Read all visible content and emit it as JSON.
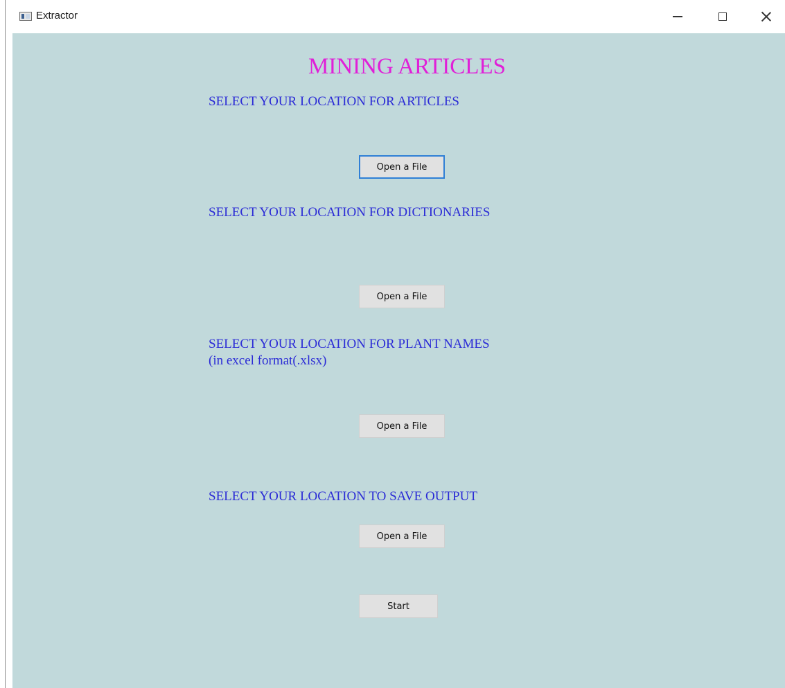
{
  "window": {
    "title": "Extractor"
  },
  "app": {
    "title": "MINING ARTICLES"
  },
  "sections": {
    "articles": {
      "label": "SELECT YOUR LOCATION FOR ARTICLES",
      "button_label": "Open a File"
    },
    "dictionaries": {
      "label": "SELECT YOUR LOCATION FOR DICTIONARIES",
      "button_label": "Open a File"
    },
    "plant_names": {
      "label": "SELECT YOUR LOCATION FOR PLANT NAMES",
      "sublabel": "(in excel format(.xlsx)",
      "button_label": "Open a File"
    },
    "output": {
      "label": "SELECT YOUR LOCATION TO SAVE OUTPUT",
      "button_label": "Open a File"
    }
  },
  "start_label": "Start",
  "colors": {
    "background": "#c1d9db",
    "title": "#e020d8",
    "label": "#2b2bd6",
    "button": "#e1e1e1",
    "focus": "#2f7fd6"
  },
  "icons": {
    "app": "app-window-icon",
    "minimize": "minimize-icon",
    "maximize": "maximize-icon",
    "close": "close-icon"
  }
}
